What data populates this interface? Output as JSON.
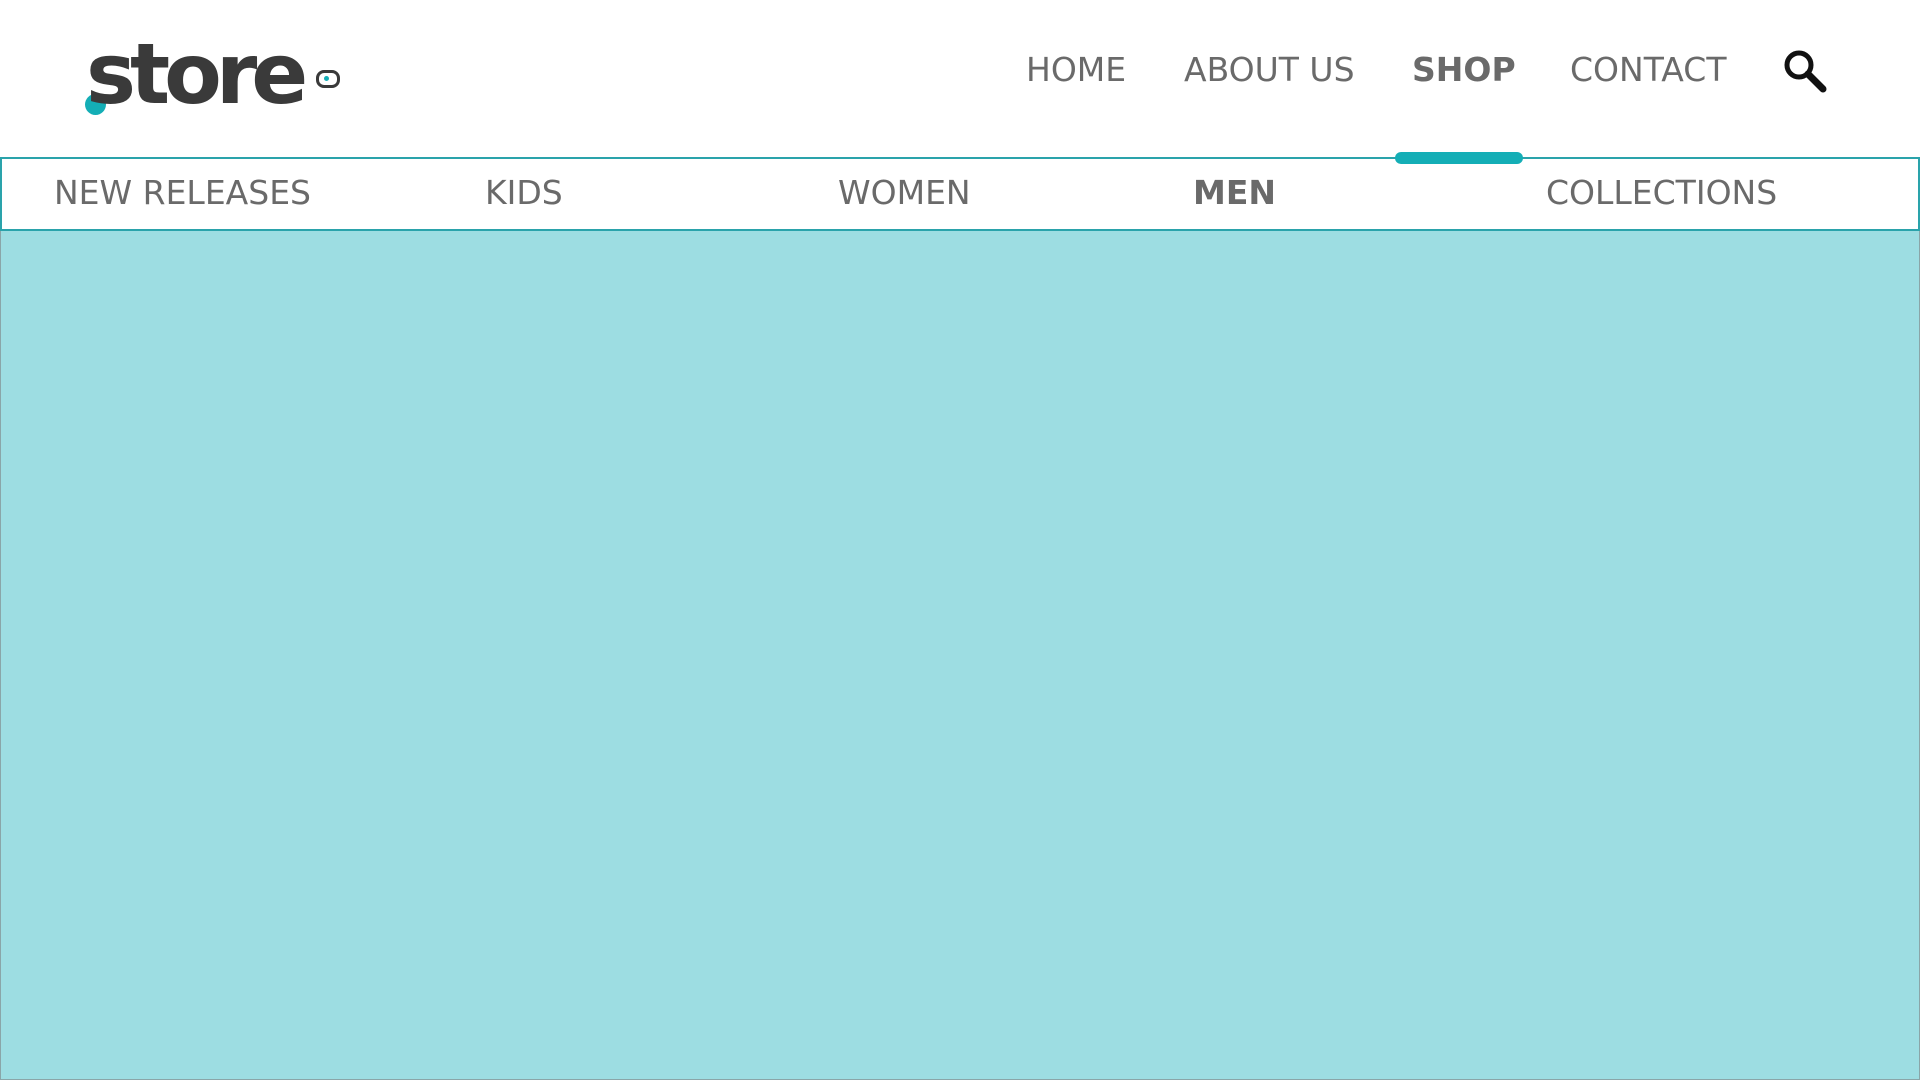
{
  "brand": {
    "logo_text": "store",
    "accent_color": "#14aeb6",
    "text_color": "#3a3a3a"
  },
  "main_nav": {
    "items": [
      {
        "label": "HOME",
        "active": false
      },
      {
        "label": "ABOUT US",
        "active": false
      },
      {
        "label": "SHOP",
        "active": true
      },
      {
        "label": "CONTACT",
        "active": false
      }
    ],
    "search_icon": "search-icon"
  },
  "sub_nav": {
    "items": [
      {
        "label": "NEW RELEASES",
        "active": false
      },
      {
        "label": "KIDS",
        "active": false
      },
      {
        "label": "WOMEN",
        "active": false
      },
      {
        "label": "MEN",
        "active": true
      },
      {
        "label": "COLLECTIONS",
        "active": false
      }
    ],
    "border_color": "#2aa3ab"
  },
  "content": {
    "background_color": "#9ddde2"
  }
}
